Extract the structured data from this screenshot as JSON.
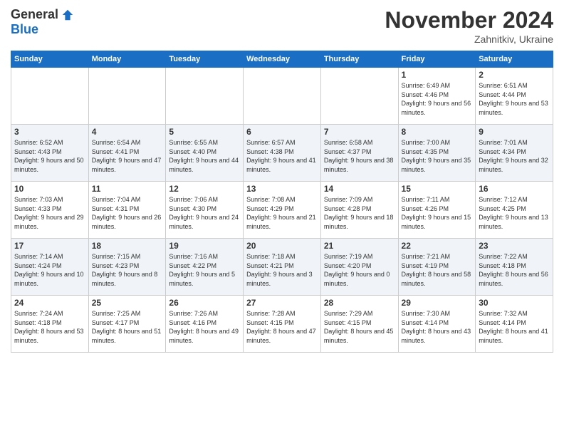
{
  "header": {
    "logo_general": "General",
    "logo_blue": "Blue",
    "month_title": "November 2024",
    "location": "Zahnitkiv, Ukraine"
  },
  "days_of_week": [
    "Sunday",
    "Monday",
    "Tuesday",
    "Wednesday",
    "Thursday",
    "Friday",
    "Saturday"
  ],
  "weeks": [
    [
      {
        "day": "",
        "info": ""
      },
      {
        "day": "",
        "info": ""
      },
      {
        "day": "",
        "info": ""
      },
      {
        "day": "",
        "info": ""
      },
      {
        "day": "",
        "info": ""
      },
      {
        "day": "1",
        "info": "Sunrise: 6:49 AM\nSunset: 4:46 PM\nDaylight: 9 hours and 56 minutes."
      },
      {
        "day": "2",
        "info": "Sunrise: 6:51 AM\nSunset: 4:44 PM\nDaylight: 9 hours and 53 minutes."
      }
    ],
    [
      {
        "day": "3",
        "info": "Sunrise: 6:52 AM\nSunset: 4:43 PM\nDaylight: 9 hours and 50 minutes."
      },
      {
        "day": "4",
        "info": "Sunrise: 6:54 AM\nSunset: 4:41 PM\nDaylight: 9 hours and 47 minutes."
      },
      {
        "day": "5",
        "info": "Sunrise: 6:55 AM\nSunset: 4:40 PM\nDaylight: 9 hours and 44 minutes."
      },
      {
        "day": "6",
        "info": "Sunrise: 6:57 AM\nSunset: 4:38 PM\nDaylight: 9 hours and 41 minutes."
      },
      {
        "day": "7",
        "info": "Sunrise: 6:58 AM\nSunset: 4:37 PM\nDaylight: 9 hours and 38 minutes."
      },
      {
        "day": "8",
        "info": "Sunrise: 7:00 AM\nSunset: 4:35 PM\nDaylight: 9 hours and 35 minutes."
      },
      {
        "day": "9",
        "info": "Sunrise: 7:01 AM\nSunset: 4:34 PM\nDaylight: 9 hours and 32 minutes."
      }
    ],
    [
      {
        "day": "10",
        "info": "Sunrise: 7:03 AM\nSunset: 4:33 PM\nDaylight: 9 hours and 29 minutes."
      },
      {
        "day": "11",
        "info": "Sunrise: 7:04 AM\nSunset: 4:31 PM\nDaylight: 9 hours and 26 minutes."
      },
      {
        "day": "12",
        "info": "Sunrise: 7:06 AM\nSunset: 4:30 PM\nDaylight: 9 hours and 24 minutes."
      },
      {
        "day": "13",
        "info": "Sunrise: 7:08 AM\nSunset: 4:29 PM\nDaylight: 9 hours and 21 minutes."
      },
      {
        "day": "14",
        "info": "Sunrise: 7:09 AM\nSunset: 4:28 PM\nDaylight: 9 hours and 18 minutes."
      },
      {
        "day": "15",
        "info": "Sunrise: 7:11 AM\nSunset: 4:26 PM\nDaylight: 9 hours and 15 minutes."
      },
      {
        "day": "16",
        "info": "Sunrise: 7:12 AM\nSunset: 4:25 PM\nDaylight: 9 hours and 13 minutes."
      }
    ],
    [
      {
        "day": "17",
        "info": "Sunrise: 7:14 AM\nSunset: 4:24 PM\nDaylight: 9 hours and 10 minutes."
      },
      {
        "day": "18",
        "info": "Sunrise: 7:15 AM\nSunset: 4:23 PM\nDaylight: 9 hours and 8 minutes."
      },
      {
        "day": "19",
        "info": "Sunrise: 7:16 AM\nSunset: 4:22 PM\nDaylight: 9 hours and 5 minutes."
      },
      {
        "day": "20",
        "info": "Sunrise: 7:18 AM\nSunset: 4:21 PM\nDaylight: 9 hours and 3 minutes."
      },
      {
        "day": "21",
        "info": "Sunrise: 7:19 AM\nSunset: 4:20 PM\nDaylight: 9 hours and 0 minutes."
      },
      {
        "day": "22",
        "info": "Sunrise: 7:21 AM\nSunset: 4:19 PM\nDaylight: 8 hours and 58 minutes."
      },
      {
        "day": "23",
        "info": "Sunrise: 7:22 AM\nSunset: 4:18 PM\nDaylight: 8 hours and 56 minutes."
      }
    ],
    [
      {
        "day": "24",
        "info": "Sunrise: 7:24 AM\nSunset: 4:18 PM\nDaylight: 8 hours and 53 minutes."
      },
      {
        "day": "25",
        "info": "Sunrise: 7:25 AM\nSunset: 4:17 PM\nDaylight: 8 hours and 51 minutes."
      },
      {
        "day": "26",
        "info": "Sunrise: 7:26 AM\nSunset: 4:16 PM\nDaylight: 8 hours and 49 minutes."
      },
      {
        "day": "27",
        "info": "Sunrise: 7:28 AM\nSunset: 4:15 PM\nDaylight: 8 hours and 47 minutes."
      },
      {
        "day": "28",
        "info": "Sunrise: 7:29 AM\nSunset: 4:15 PM\nDaylight: 8 hours and 45 minutes."
      },
      {
        "day": "29",
        "info": "Sunrise: 7:30 AM\nSunset: 4:14 PM\nDaylight: 8 hours and 43 minutes."
      },
      {
        "day": "30",
        "info": "Sunrise: 7:32 AM\nSunset: 4:14 PM\nDaylight: 8 hours and 41 minutes."
      }
    ]
  ]
}
